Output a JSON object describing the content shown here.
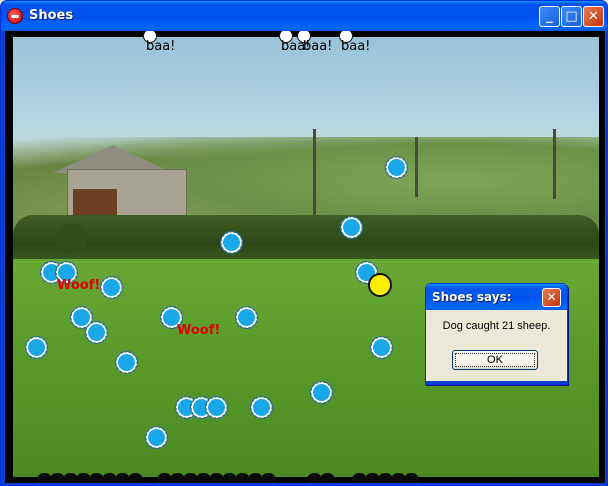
{
  "window": {
    "title": "Shoes",
    "minimize_label": "_",
    "maximize_label": "□",
    "close_label": "✕",
    "app_icon": "shoes-icon"
  },
  "game": {
    "baa_labels": [
      "baa!",
      "baa!",
      "baa!",
      "baa!"
    ],
    "woof_labels": [
      "Woof!",
      "Woof!"
    ],
    "sheep_count": 27,
    "dog_color": "#ffee00",
    "sheep_color": "#1aa7e8"
  },
  "dialog": {
    "title": "Shoes says:",
    "message": "Dog caught 21 sheep.",
    "ok_label": "OK",
    "close_label": "✕"
  }
}
